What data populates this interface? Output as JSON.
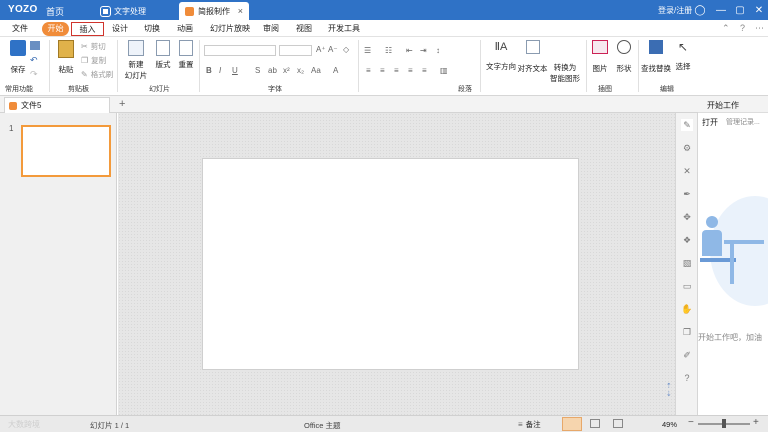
{
  "titlebar": {
    "logo": "YOZO",
    "home": "首页",
    "tabs": [
      {
        "label": "文字处理"
      },
      {
        "label": "简报制作"
      }
    ],
    "login": "登录/注册",
    "close_tab": "×"
  },
  "menu": {
    "items": [
      "文件",
      "开始",
      "插入",
      "设计",
      "切换",
      "动画",
      "幻灯片放映",
      "审阅",
      "视图",
      "开发工具"
    ]
  },
  "ribbon": {
    "save": "保存",
    "paste": "粘贴",
    "cut": "剪切",
    "copy": "复制",
    "format_painter": "格式刷",
    "new_slide": "新建",
    "new_slide2": "幻灯片",
    "layout": "版式",
    "reset": "重置",
    "text_direction": "文字方向",
    "align_text": "对齐文本",
    "convert_smartart": "转换为",
    "convert_smartart2": "智能图形",
    "picture": "图片",
    "shape": "形状",
    "find_replace": "查找替换",
    "select": "选择",
    "groups": [
      "常用功能",
      "剪贴板",
      "幻灯片",
      "字体",
      "段落",
      "插图",
      "编辑"
    ]
  },
  "doc": {
    "tab_label": "文件5",
    "add_tab": "+"
  },
  "thumbs": {
    "number": "1"
  },
  "taskpane": {
    "title": "开始工作",
    "open": "打开",
    "manage": "管理记录...",
    "watermark_text": "开始工作吧，加油"
  },
  "status": {
    "slide_info": "幻灯片 1 / 1",
    "theme": "Office 主题",
    "notes": "备注",
    "zoom": "49%",
    "watermark": "大数跨境"
  },
  "colors": {
    "titlebar": "#2f72c6",
    "accent": "#f08c3a",
    "active_border": "#d0342c"
  }
}
